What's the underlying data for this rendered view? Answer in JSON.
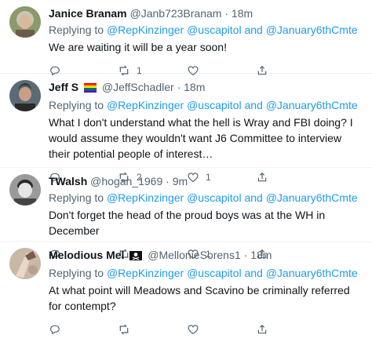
{
  "tweets": [
    {
      "name": "Janice Branam",
      "handle": "@Janb723Branam",
      "dot": "·",
      "time": "18m",
      "badge": "",
      "replying_prefix": "Replying to",
      "mentions": [
        "@RepKinzinger",
        "@uscapitol",
        "@January6thCmte"
      ],
      "and_word": "and",
      "text": "We are waiting it will be a year soon!",
      "counts": {
        "reply": "",
        "retweet": "1",
        "like": ""
      },
      "avatar_colors": {
        "bg": "#8a9a6a",
        "face": "#d9b99b",
        "hair": "#c9c3b8"
      }
    },
    {
      "name": "Jeff S",
      "handle": "@JeffSchadler",
      "dot": "·",
      "time": "18m",
      "badge": "rainbow-flag",
      "replying_prefix": "Replying to",
      "mentions": [
        "@RepKinzinger",
        "@uscapitol",
        "@January6thCmte"
      ],
      "and_word": "and",
      "text": "What I don't understand what the hell is Wray and FBI doing? I would assume they wouldn't want J6 Committee to interview their potential people of interest…",
      "counts": {
        "reply": "",
        "retweet": "2",
        "like": "1"
      },
      "avatar_colors": {
        "bg": "#5b6b74",
        "face": "#c99e86",
        "hair": "#3a3a3a"
      }
    },
    {
      "name": "TWalsh",
      "handle": "@hogan_1969",
      "dot": "·",
      "time": "9m",
      "badge": "",
      "replying_prefix": "Replying to",
      "mentions": [
        "@RepKinzinger",
        "@uscapitol",
        "@January6thCmte"
      ],
      "and_word": "and",
      "text": "Don't forget the head of the proud boys was at the WH in December",
      "counts": {
        "reply": "",
        "retweet": "",
        "like": "1"
      },
      "avatar_colors": {
        "bg": "#9a9a9a",
        "face": "#e6e6e6",
        "hair": "#2b2b2b"
      }
    },
    {
      "name": "Melodious Mel",
      "handle": "@MellonieSorens1",
      "dot": "·",
      "time": "18m",
      "badge": "pirate-flag",
      "replying_prefix": "Replying to",
      "mentions": [
        "@RepKinzinger",
        "@uscapitol",
        "@January6thCmte"
      ],
      "and_word": "and",
      "text": "At what point will Meadows and Scavino be criminally referred for contempt?",
      "counts": {
        "reply": "",
        "retweet": "",
        "like": ""
      },
      "avatar_colors": {
        "bg": "#c9b8a6",
        "face": "#e8d8c8",
        "hair": "#7a5a4a"
      }
    }
  ],
  "colors": {
    "link": "#1d9bf0",
    "muted": "#536471",
    "text": "#0f1419"
  }
}
